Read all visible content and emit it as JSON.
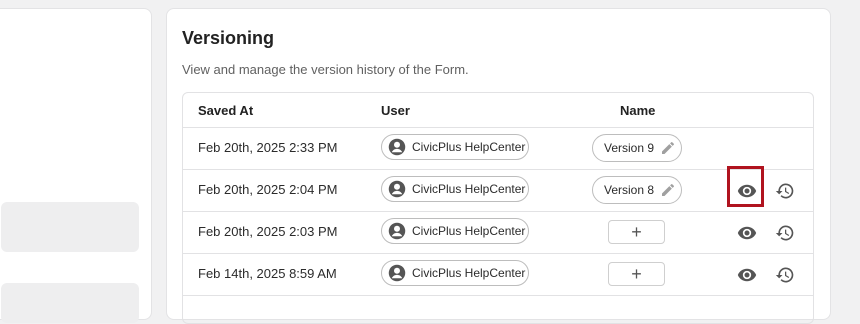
{
  "versioning": {
    "title": "Versioning",
    "subtitle": "View and manage the version history of the Form.",
    "headers": {
      "saved_at": "Saved At",
      "user": "User",
      "name": "Name"
    },
    "rows": [
      {
        "saved_at": "Feb 20th, 2025 2:33 PM",
        "user": "CivicPlus HelpCenter",
        "name": "Version 9"
      },
      {
        "saved_at": "Feb 20th, 2025 2:04 PM",
        "user": "CivicPlus HelpCenter",
        "name": "Version 8"
      },
      {
        "saved_at": "Feb 20th, 2025 2:03 PM",
        "user": "CivicPlus HelpCenter",
        "add_label": "+"
      },
      {
        "saved_at": "Feb 14th, 2025 8:59 AM",
        "user": "CivicPlus HelpCenter",
        "add_label": "+"
      }
    ]
  },
  "icons": {
    "avatar": "account-circle-icon",
    "pencil": "pencil-icon",
    "view": "eye-icon",
    "restore": "history-icon"
  },
  "colors": {
    "highlight": "#b0131f",
    "icon": "#555555"
  }
}
